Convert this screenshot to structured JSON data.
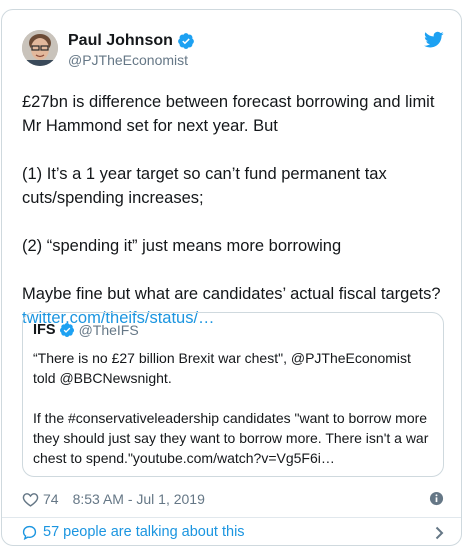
{
  "author": {
    "name": "Paul Johnson",
    "handle": "@PJTheEconomist"
  },
  "tweet": {
    "para1": "£27bn is difference between forecast borrowing and limit Mr Hammond set for next year. But",
    "para2": "(1) It’s a 1 year target so can’t fund permanent tax cuts/spending increases;",
    "para3": "(2) “spending it” just means more borrowing",
    "para4": "Maybe fine but what are candidates’ actual fiscal targets?",
    "link": "twitter.com/theifs/status/…"
  },
  "quoted": {
    "name": "IFS",
    "handle": "@TheIFS",
    "para1": "“There is no £27 billion Brexit war chest\", @PJTheEconomist told @BBCNewsnight.",
    "para2": "If the #conservativeleadership candidates \"want to borrow more they should just say they want to borrow more. There isn't a war chest to spend.\"youtube.com/watch?v=Vg5F6i…"
  },
  "meta": {
    "likes": "74",
    "timestamp": "8:53 AM - Jul 1, 2019"
  },
  "footer": {
    "talking": "57 people are talking about this"
  },
  "icons": {
    "verified": "verified-badge-icon",
    "twitter": "twitter-bird-icon",
    "heart": "heart-icon",
    "info": "info-icon",
    "bubble": "speech-bubble-icon",
    "chevron": "chevron-right-icon"
  },
  "colors": {
    "accent": "#1da1f2",
    "link": "#1b95e0",
    "secondary_text": "#657786"
  }
}
